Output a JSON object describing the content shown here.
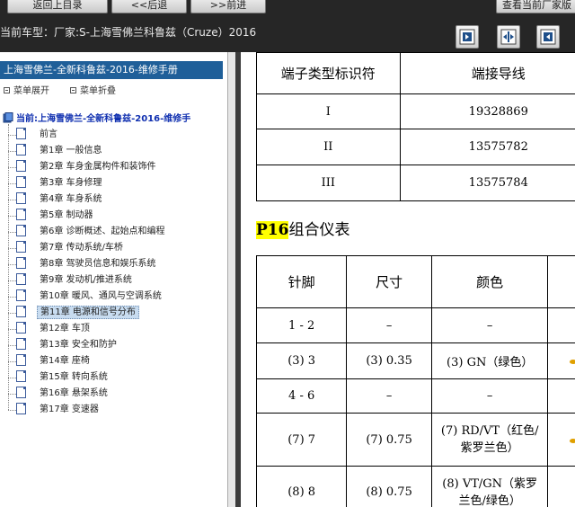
{
  "topbar": {
    "buttons": [
      {
        "label": "返回上目录"
      },
      {
        "label": "<<后退"
      },
      {
        "label": ">>前进"
      },
      {
        "label": "查看当前厂家版"
      }
    ],
    "vehicle_text": "当前车型：厂家:S-上海雪佛兰科鲁兹（Cruze）2016",
    "view_controls": [
      "expand-right-icon",
      "split-view-icon",
      "collapse-left-icon"
    ]
  },
  "sidebar": {
    "manual_title": "上海雪佛兰-全新科鲁兹-2016-维修手册",
    "expand_label": "菜单展开",
    "collapse_label": "菜单折叠",
    "root_label": "当前:上海雪佛兰-全新科鲁兹-2016-维修手",
    "items": [
      {
        "label": "前言"
      },
      {
        "label": "第1章  一般信息"
      },
      {
        "label": "第2章  车身金属构件和装饰件"
      },
      {
        "label": "第3章  车身修理"
      },
      {
        "label": "第4章  车身系统"
      },
      {
        "label": "第5章  制动器"
      },
      {
        "label": "第6章  诊断概述、起始点和编程"
      },
      {
        "label": "第7章  传动系统/车桥"
      },
      {
        "label": "第8章  驾驶员信息和娱乐系统"
      },
      {
        "label": "第9章  发动机/推进系统"
      },
      {
        "label": "第10章  暖风、通风与空调系统"
      },
      {
        "label": "第11章  电源和信号分布"
      },
      {
        "label": "第12章  车顶"
      },
      {
        "label": "第13章  安全和防护"
      },
      {
        "label": "第14章  座椅"
      },
      {
        "label": "第15章  转向系统"
      },
      {
        "label": "第16章  悬架系统"
      },
      {
        "label": "第17章  变速器"
      }
    ],
    "selected_index": 11
  },
  "content": {
    "terminal_table": {
      "headers": [
        "端子类型标识符",
        "端接导线"
      ],
      "rows": [
        [
          "I",
          "19328869"
        ],
        [
          "II",
          "13575782"
        ],
        [
          "III",
          "13575784"
        ]
      ]
    },
    "section": {
      "code": "P16",
      "title": "组合仪表"
    },
    "pin_table": {
      "headers": [
        "针脚",
        "尺寸",
        "颜色"
      ],
      "rows": [
        [
          "1 - 2",
          "–",
          "–"
        ],
        [
          "(3) 3",
          "(3) 0.35",
          "(3) GN（绿色）"
        ],
        [
          "4 - 6",
          "–",
          "–"
        ],
        [
          "(7) 7",
          "(7) 0.75",
          "(7) RD/VT（红色/紫罗兰色）"
        ],
        [
          "(8) 8",
          "(8) 0.75",
          "(8) VT/GN（紫罗兰色/绿色）"
        ]
      ]
    }
  }
}
